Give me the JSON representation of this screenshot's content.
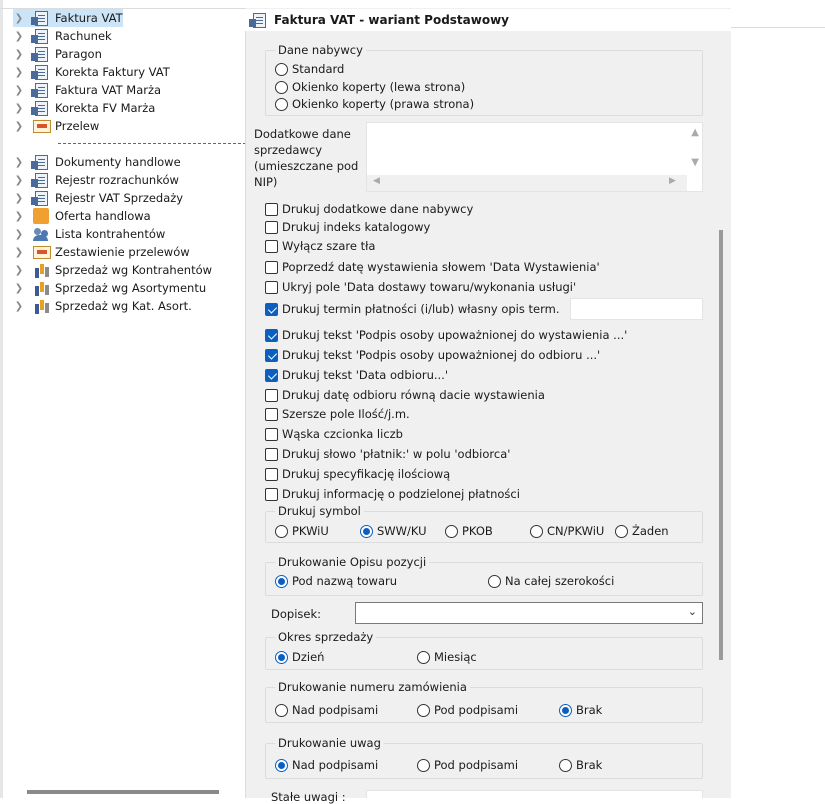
{
  "tree": {
    "items": [
      {
        "label": "Faktura VAT",
        "icon": "document-icon",
        "selected": true
      },
      {
        "label": "Rachunek",
        "icon": "document-icon"
      },
      {
        "label": "Paragon",
        "icon": "document-icon"
      },
      {
        "label": "Korekta Faktury VAT",
        "icon": "document-icon"
      },
      {
        "label": "Faktura VAT Marża",
        "icon": "document-icon"
      },
      {
        "label": "Korekta FV Marża",
        "icon": "document-icon"
      },
      {
        "label": "Przelew",
        "icon": "payment-icon"
      }
    ],
    "items2": [
      {
        "label": "Dokumenty handlowe",
        "icon": "document-icon"
      },
      {
        "label": "Rejestr rozrachunków",
        "icon": "document-icon"
      },
      {
        "label": "Rejestr VAT Sprzedaży",
        "icon": "document-icon"
      },
      {
        "label": "Oferta handlowa",
        "icon": "offer-icon"
      },
      {
        "label": "Lista kontrahentów",
        "icon": "people-icon"
      },
      {
        "label": "Zestawienie przelewów",
        "icon": "payment-icon"
      },
      {
        "label": "Sprzedaż wg Kontrahentów",
        "icon": "bar-chart-icon"
      },
      {
        "label": "Sprzedaż wg Asortymentu",
        "icon": "bar-chart-icon"
      },
      {
        "label": "Sprzedaż wg Kat. Asort.",
        "icon": "bar-chart-icon"
      }
    ]
  },
  "panel": {
    "title": "Faktura VAT - wariant Podstawowy",
    "dane_nabywcy": {
      "label": "Dane nabywcy",
      "options": [
        "Standard",
        "Okienko koperty (lewa strona)",
        "Okienko koperty (prawa strona)"
      ],
      "selected": null
    },
    "dodatkowe_label": [
      "Dodatkowe dane",
      "sprzedawcy",
      "(umieszczane pod",
      "NIP)"
    ],
    "checkboxes": [
      {
        "label": "Drukuj dodatkowe dane nabywcy",
        "checked": false
      },
      {
        "label": "Drukuj indeks katalogowy",
        "checked": false
      },
      {
        "label": "Wyłącz szare tła",
        "checked": false
      },
      {
        "label": "Poprzedź datę wystawienia słowem 'Data Wystawienia'",
        "checked": false
      },
      {
        "label": "Ukryj pole 'Data dostawy towaru/wykonania usługi'",
        "checked": false
      },
      {
        "label": "Drukuj termin płatności  (i/lub) własny opis term.",
        "checked": true
      },
      {
        "label": "Drukuj tekst 'Podpis osoby upoważnionej do wystawienia ...'",
        "checked": true
      },
      {
        "label": "Drukuj tekst 'Podpis osoby upoważnionej do odbioru ...'",
        "checked": true
      },
      {
        "label": "Drukuj tekst 'Data odbioru...'",
        "checked": true
      },
      {
        "label": "Drukuj datę odbioru równą dacie wystawienia",
        "checked": false
      },
      {
        "label": "Szersze pole Ilość/j.m.",
        "checked": false
      },
      {
        "label": "Wąska czcionka liczb",
        "checked": false
      },
      {
        "label": "Drukuj słowo 'płatnik:' w polu 'odbiorca'",
        "checked": false
      },
      {
        "label": "Drukuj specyfikację ilościową",
        "checked": false
      },
      {
        "label": "Drukuj informację o podzielonej płatności",
        "checked": false
      }
    ],
    "drukuj_symbol": {
      "label": "Drukuj symbol",
      "options": [
        "PKWiU",
        "SWW/KU",
        "PKOB",
        "CN/PKWiU",
        "Żaden"
      ],
      "selected": "SWW/KU"
    },
    "opis_pozycji": {
      "label": "Drukowanie Opisu pozycji",
      "options": [
        "Pod nazwą towaru",
        "Na całej szerokości"
      ],
      "selected": "Pod nazwą towaru"
    },
    "dopisek_label": "Dopisek:",
    "dopisek_value": "",
    "okres": {
      "label": "Okres sprzedaży",
      "options": [
        "Dzień",
        "Miesiąc"
      ],
      "selected": "Dzień"
    },
    "numer_zam": {
      "label": "Drukowanie numeru zamówienia",
      "options": [
        "Nad podpisami",
        "Pod podpisami",
        "Brak"
      ],
      "selected": "Brak"
    },
    "uwagi": {
      "label": "Drukowanie uwag",
      "options": [
        "Nad podpisami",
        "Pod podpisami",
        "Brak"
      ],
      "selected": "Nad podpisami"
    },
    "stale_uwagi_label": "Stałe uwagi :"
  }
}
